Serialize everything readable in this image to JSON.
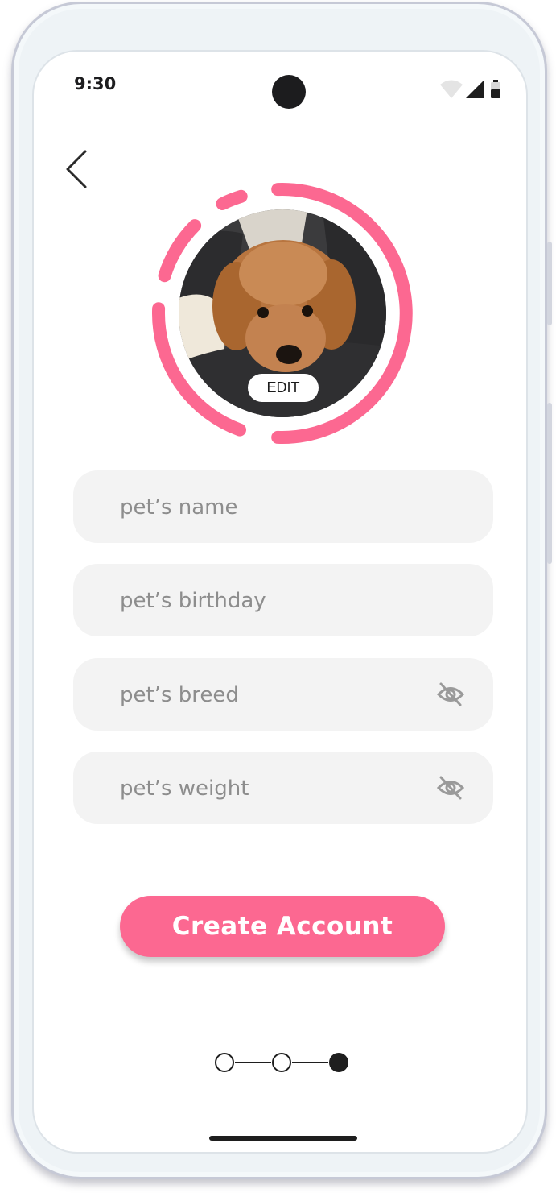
{
  "status_bar": {
    "time": "9:30"
  },
  "header": {
    "back_icon": "chevron-left-icon"
  },
  "avatar": {
    "edit_label": "EDIT",
    "ring_color": "#fc6891",
    "photo": "curly-brown-dog-photo"
  },
  "form": {
    "fields": [
      {
        "placeholder": "pet’s name",
        "value": ""
      },
      {
        "placeholder": "pet’s birthday",
        "value": ""
      },
      {
        "placeholder": "pet’s breed",
        "value": "",
        "icon": "eye-off-icon"
      },
      {
        "placeholder": "pet’s weight",
        "value": "",
        "icon": "eye-off-icon"
      }
    ]
  },
  "actions": {
    "create_account_label": "Create Account",
    "accent_color": "#fc6891"
  },
  "progress": {
    "steps_total": 3,
    "current_step": 3
  }
}
